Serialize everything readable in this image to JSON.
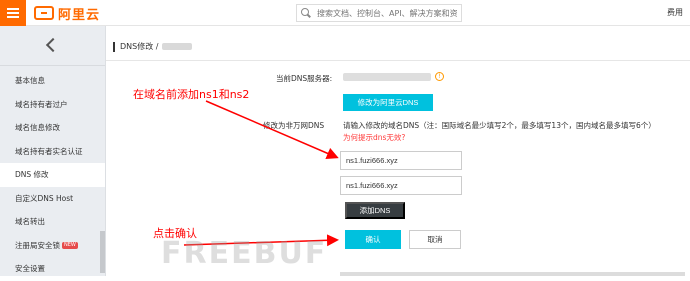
{
  "header": {
    "logo_text": "阿里云",
    "search_placeholder": "搜索文档、控制台、API、解决方案和资源",
    "fee_label": "费用"
  },
  "sidebar": {
    "items": [
      {
        "label": "基本信息"
      },
      {
        "label": "域名持有者过户"
      },
      {
        "label": "域名信息修改"
      },
      {
        "label": "域名持有者实名认证"
      },
      {
        "label": "DNS 修改"
      },
      {
        "label": "自定义DNS Host"
      },
      {
        "label": "域名转出"
      },
      {
        "label": "注册局安全锁",
        "badge": "NEW"
      },
      {
        "label": "安全设置"
      }
    ],
    "active_index": 4
  },
  "breadcrumb": {
    "text": "DNS修改 /"
  },
  "form": {
    "current_dns_label": "当前DNS服务器:",
    "modify_to_aliyun_button": "修改为阿里云DNS",
    "non_aliyun_label": "修改为非万网DNS",
    "instruction": "请输入修改的域名DNS（注：国际域名最少填写2个，最多填写13个，国内域名最多填写6个）",
    "hint_link": "为何提示dns无效?",
    "dns_inputs": [
      "ns1.fuzi666.xyz",
      "ns1.fuzi666.xyz"
    ],
    "add_dns_button": "添加DNS",
    "confirm_button": "确认",
    "cancel_button": "取消"
  },
  "annotations": {
    "top": "在域名前添加ns1和ns2",
    "bottom": "点击确认"
  },
  "watermark": "FREEBUF",
  "colors": {
    "accent": "#ff6a00",
    "primary_button": "#00c1de",
    "annotation": "#ff0000"
  }
}
